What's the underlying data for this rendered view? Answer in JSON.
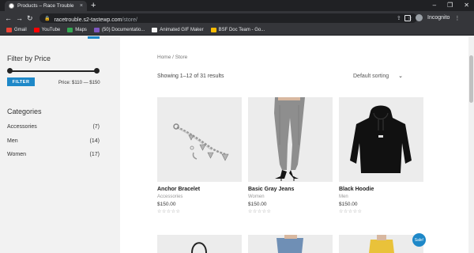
{
  "browser": {
    "tab_title": "Products – Race Trouble",
    "tab_close": "×",
    "new_tab": "+",
    "win_min": "–",
    "win_max": "❐",
    "win_close": "✕",
    "back": "←",
    "forward": "→",
    "reload": "↻",
    "url_host": "racetrouble.s2-tastewp.com",
    "url_path": "/store/",
    "incognito_label": "Incognito",
    "bookmarks": [
      {
        "label": "Gmail",
        "icon": "gmail-icon",
        "color": "#ea4335"
      },
      {
        "label": "YouTube",
        "icon": "youtube-icon",
        "color": "#ff0000"
      },
      {
        "label": "Maps",
        "icon": "maps-icon",
        "color": "#34a853"
      },
      {
        "label": "(50) Documentatio...",
        "icon": "documentation-icon",
        "color": "#7e57c2"
      },
      {
        "label": "Animated GIF Maker",
        "icon": "gif-maker-icon",
        "color": "#f5f5f5"
      },
      {
        "label": "BSF Doc Team - Go...",
        "icon": "bsf-doc-icon",
        "color": "#fbbc04"
      }
    ]
  },
  "sidebar": {
    "filter_heading": "Filter by Price",
    "filter_button": "FILTER",
    "price_prefix": "Price: ",
    "price_range": "$110 — $150",
    "categories_heading": "Categories",
    "categories": [
      {
        "name": "Accessories",
        "count": "(7)"
      },
      {
        "name": "Men",
        "count": "(14)"
      },
      {
        "name": "Women",
        "count": "(17)"
      }
    ]
  },
  "main": {
    "breadcrumb": "Home / Store",
    "results": "Showing 1–12 of 31 results",
    "sorting": "Default sorting",
    "products": [
      {
        "name": "Anchor Bracelet",
        "category": "Accessories",
        "price": "$150.00",
        "stars": "☆☆☆☆☆"
      },
      {
        "name": "Basic Gray Jeans",
        "category": "Women",
        "price": "$150.00",
        "stars": "☆☆☆☆☆"
      },
      {
        "name": "Black Hoodie",
        "category": "Men",
        "price": "$150.00",
        "stars": "☆☆☆☆☆"
      }
    ],
    "sale_badge": "Sale!"
  },
  "colors": {
    "accent": "#1e88c8",
    "browser_dark": "#202124",
    "browser_mid": "#35363a"
  }
}
